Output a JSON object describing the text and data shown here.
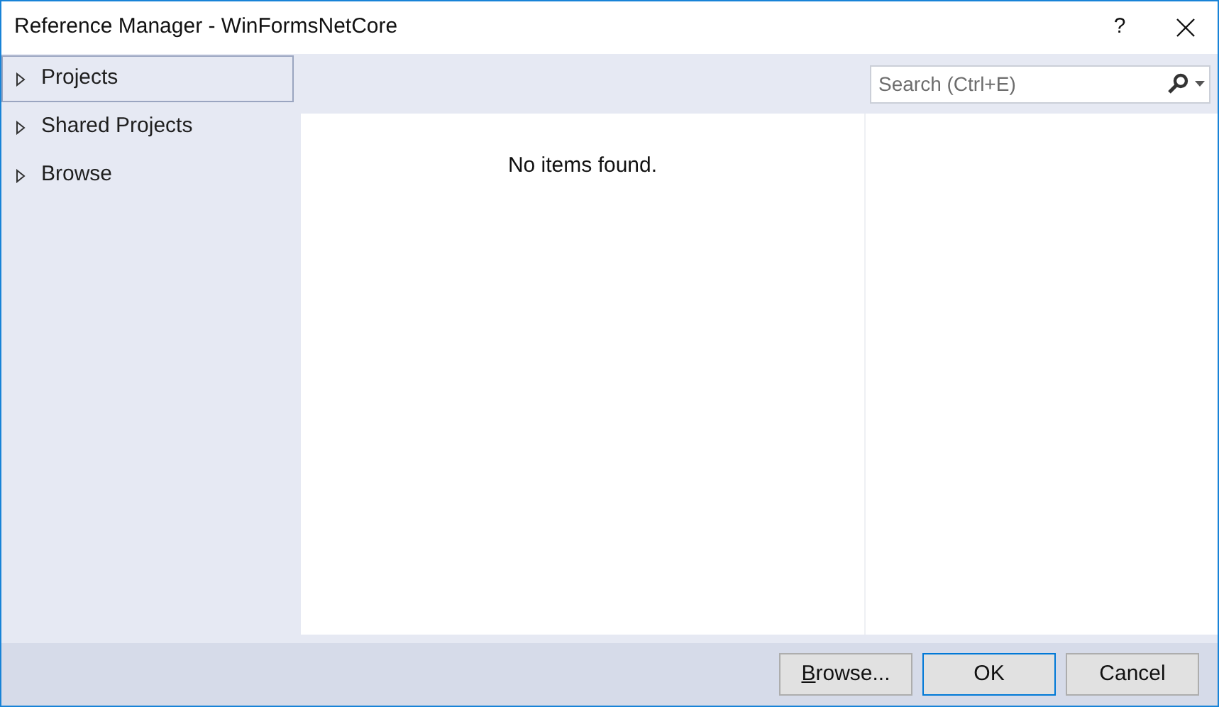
{
  "window": {
    "title": "Reference Manager - WinFormsNetCore",
    "help": "?"
  },
  "sidebar": {
    "items": [
      {
        "label": "Projects",
        "selected": true,
        "expanded": false
      },
      {
        "label": "Shared Projects",
        "selected": false,
        "expanded": false
      },
      {
        "label": "Browse",
        "selected": false,
        "expanded": false
      }
    ]
  },
  "search": {
    "placeholder": "Search (Ctrl+E)"
  },
  "list": {
    "empty_message": "No items found."
  },
  "buttons": [
    {
      "label": "Browse...",
      "mnemonic": true,
      "default": false
    },
    {
      "label": "OK",
      "default": true
    },
    {
      "label": "Cancel",
      "default": false
    }
  ]
}
